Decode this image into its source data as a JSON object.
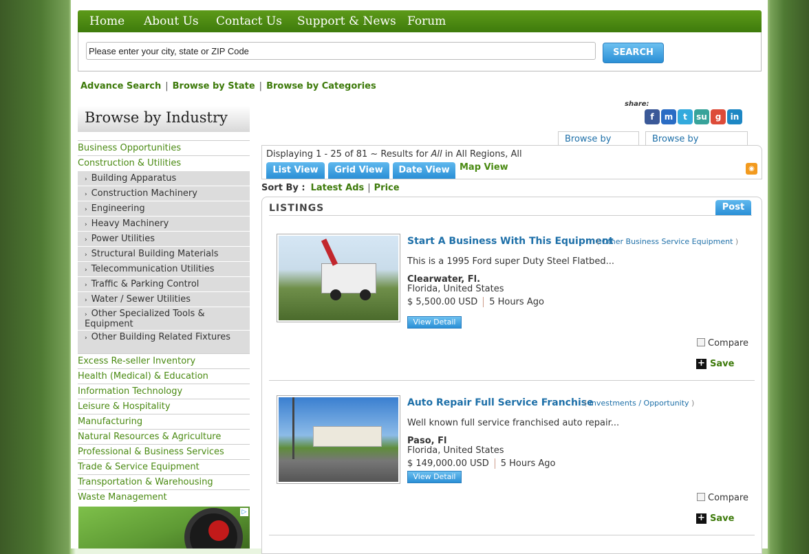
{
  "nav": {
    "items": [
      "Home",
      "About Us",
      "Contact Us",
      "Support & News",
      "Forum"
    ]
  },
  "search": {
    "value": "Please enter your city, state or ZIP Code",
    "button": "SEARCH"
  },
  "sublinks": {
    "advance": "Advance Search",
    "state": "Browse by State",
    "categories": "Browse by Categories",
    "sep": "|"
  },
  "sidebar": {
    "title": "Browse by Industry",
    "items": [
      {
        "label": "Business Opportunities",
        "type": "item"
      },
      {
        "label": "Construction & Utilities",
        "type": "item"
      },
      {
        "label": "Building Apparatus",
        "type": "sub"
      },
      {
        "label": "Construction Machinery",
        "type": "sub"
      },
      {
        "label": "Engineering",
        "type": "sub"
      },
      {
        "label": "Heavy Machinery",
        "type": "sub"
      },
      {
        "label": "Power Utilities",
        "type": "sub"
      },
      {
        "label": "Structural Building Materials",
        "type": "sub"
      },
      {
        "label": "Telecommunication Utilities",
        "type": "sub"
      },
      {
        "label": "Traffic & Parking Control",
        "type": "sub"
      },
      {
        "label": "Water / Sewer Utilities",
        "type": "sub"
      },
      {
        "label": "Other Specialized Tools & Equipment",
        "type": "sub"
      },
      {
        "label": "Other Building Related Fixtures",
        "type": "sub"
      },
      {
        "label": "Excess Re-seller Inventory",
        "type": "item"
      },
      {
        "label": "Health (Medical) & Education",
        "type": "item"
      },
      {
        "label": "Information Technology",
        "type": "item"
      },
      {
        "label": "Leisure & Hospitality",
        "type": "item"
      },
      {
        "label": "Manufacturing",
        "type": "item"
      },
      {
        "label": "Natural Resources & Agriculture",
        "type": "item"
      },
      {
        "label": "Professional & Business Services",
        "type": "item"
      },
      {
        "label": "Trade & Service Equipment",
        "type": "item"
      },
      {
        "label": "Transportation & Warehousing",
        "type": "item"
      },
      {
        "label": "Waste Management",
        "type": "item"
      }
    ],
    "sub_arrow": "›",
    "ad_choice": "▷"
  },
  "share": {
    "label": "share:",
    "icons": [
      {
        "name": "facebook-icon",
        "glyph": "f",
        "color": "#3b5998"
      },
      {
        "name": "myspace-icon",
        "glyph": "m",
        "color": "#2a6cc4"
      },
      {
        "name": "twitter-icon",
        "glyph": "t",
        "color": "#33aadd"
      },
      {
        "name": "stumbleupon-icon",
        "glyph": "su",
        "color": "#37a39a"
      },
      {
        "name": "google-icon",
        "glyph": "g",
        "color": "#dd4b39"
      },
      {
        "name": "linkedin-icon",
        "glyph": "in",
        "color": "#1d87c4"
      }
    ]
  },
  "tabs": {
    "state": "Browse by State",
    "categories": "Browse by Categories"
  },
  "results": {
    "prefix": "Displaying 1 - 25 of 81 ~ Results for ",
    "query": "All",
    "suffix": " in All Regions, All",
    "views": [
      "List View",
      "Grid View",
      "Date View"
    ],
    "map_view": "Map View",
    "rss_glyph": "◉"
  },
  "sort": {
    "label": "Sort By :",
    "latest": "Latest Ads",
    "sep": "|",
    "price": "Price"
  },
  "listings": {
    "heading": "LISTINGS",
    "post": "Post",
    "items": [
      {
        "title": "Start A Business With This Equipment",
        "category": "Other Business Service Equipment",
        "description": "This is a 1995 Ford super Duty Steel Flatbed...",
        "city": "Clearwater, Fl.",
        "region": "Florida, United States",
        "price": "$ 5,500.00 USD",
        "age": "5 Hours Ago",
        "detail": "View Detail",
        "compare": "Compare",
        "save": "Save"
      },
      {
        "title": "Auto Repair Full Service Franchise",
        "category": "Investments / Opportunity",
        "description": "Well known full service franchised auto repair...",
        "city": "Paso, Fl",
        "region": "Florida, United States",
        "price": "$ 149,000.00 USD",
        "age": "5 Hours Ago",
        "detail": "View Detail",
        "compare": "Compare",
        "save": "Save"
      }
    ],
    "paren_open": "(",
    "paren_close": ")",
    "save_glyph": "+"
  }
}
